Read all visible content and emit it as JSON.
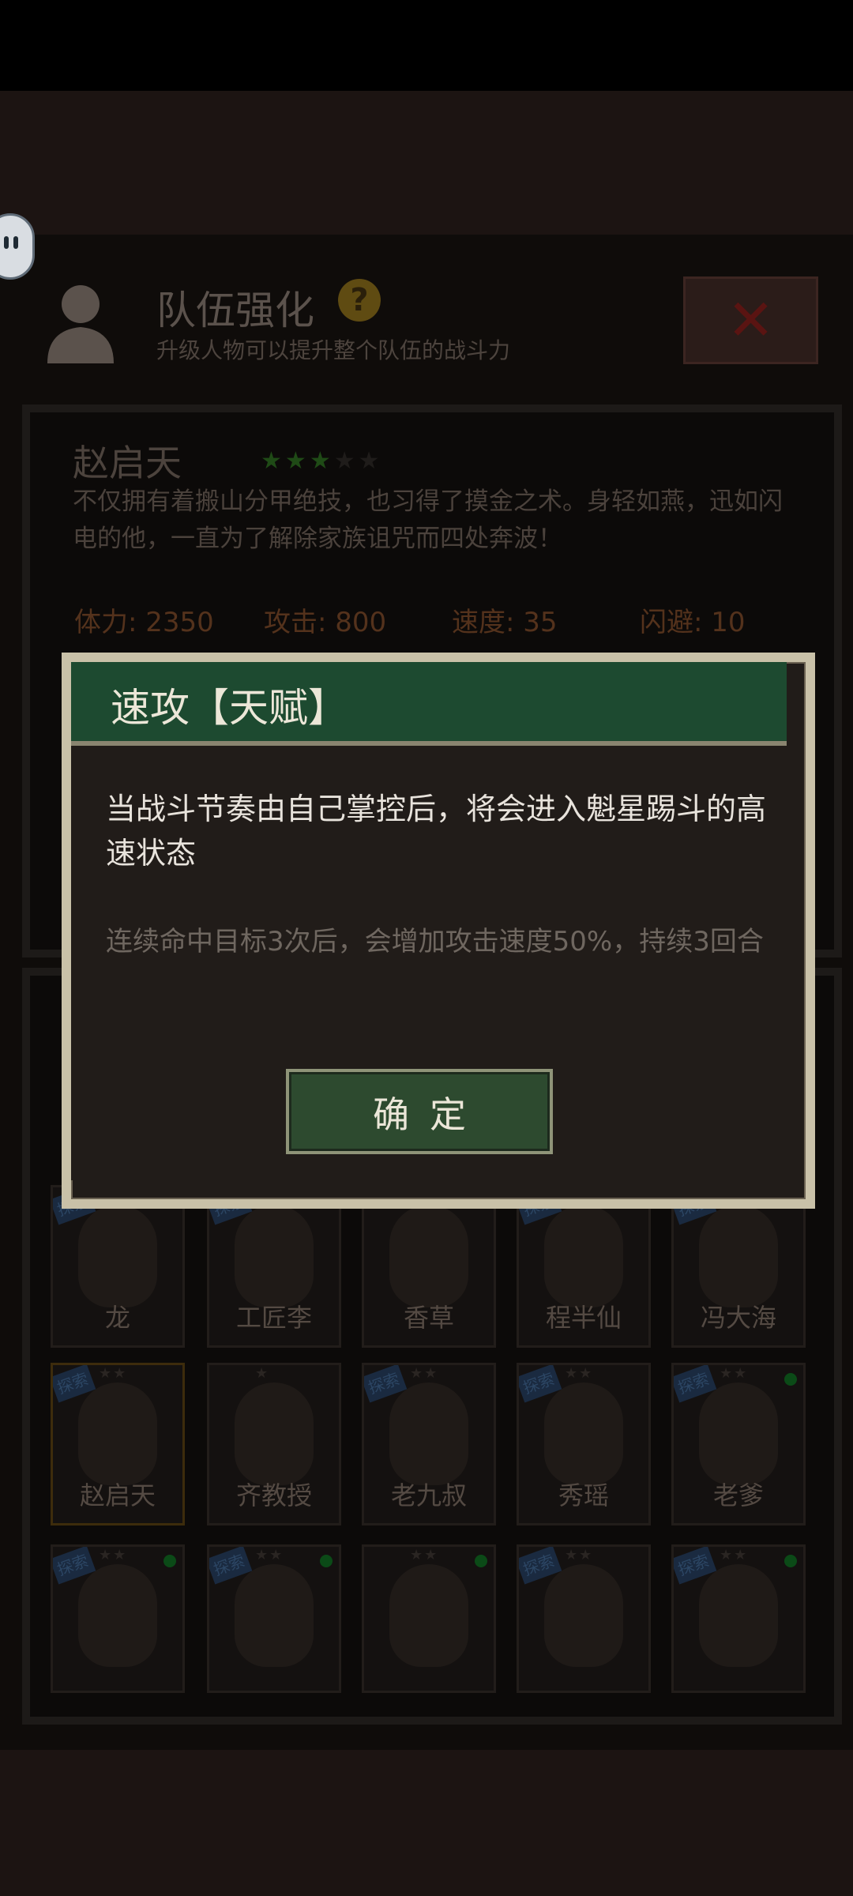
{
  "header": {
    "title": "队伍强化",
    "help_icon": "question-icon",
    "subtitle": "升级人物可以提升整个队伍的战斗力",
    "close_icon": "close-x-icon"
  },
  "hero": {
    "name": "赵启天",
    "stars": "★★★★★",
    "rating": 3,
    "max_rating": 5,
    "description": "不仅拥有着搬山分甲绝技，也习得了摸金之术。身轻如燕，迅如闪电的他，一直为了解除家族诅咒而四处奔波！",
    "stats": {
      "hp": "体力: 2350",
      "attack": "攻击: 800",
      "speed": "速度: 35",
      "evade": "闪避: 10"
    }
  },
  "roster": {
    "tag_label": "探索",
    "row1": [
      {
        "name": "龙",
        "stars": "",
        "tag": true,
        "online": false
      },
      {
        "name": "工匠李",
        "stars": "",
        "tag": true,
        "online": false
      },
      {
        "name": "香草",
        "stars": "",
        "tag": false,
        "online": false
      },
      {
        "name": "程半仙",
        "stars": "",
        "tag": true,
        "online": true
      },
      {
        "name": "冯大海",
        "stars": "",
        "tag": true,
        "online": false
      }
    ],
    "row2": [
      {
        "name": "赵启天",
        "stars": "★★",
        "tag": true,
        "online": false
      },
      {
        "name": "齐教授",
        "stars": "★",
        "tag": false,
        "online": false
      },
      {
        "name": "老九叔",
        "stars": "★★",
        "tag": true,
        "online": false
      },
      {
        "name": "秀瑶",
        "stars": "★★",
        "tag": true,
        "online": false
      },
      {
        "name": "老爹",
        "stars": "★★",
        "tag": true,
        "online": true
      }
    ],
    "row3": [
      {
        "name": "",
        "stars": "★★",
        "tag": true,
        "online": true
      },
      {
        "name": "",
        "stars": "★★",
        "tag": true,
        "online": true
      },
      {
        "name": "",
        "stars": "★★",
        "tag": false,
        "online": true
      },
      {
        "name": "",
        "stars": "★★",
        "tag": true,
        "online": false
      },
      {
        "name": "",
        "stars": "★★",
        "tag": true,
        "online": true
      }
    ]
  },
  "dialog": {
    "title": "速攻【天赋】",
    "description": "当战斗节奏由自己掌控后，将会进入魁星踢斗的高速状态",
    "effect": "连续命中目标3次后，会增加攻击速度50%，持续3回合",
    "confirm_label": "确定"
  },
  "colors": {
    "dialog_header": "#1d4a30",
    "dialog_border": "#c9c1a8",
    "confirm_button": "#2d4a2f",
    "star_active": "#1f4a16",
    "close_x": "#5a1412"
  }
}
